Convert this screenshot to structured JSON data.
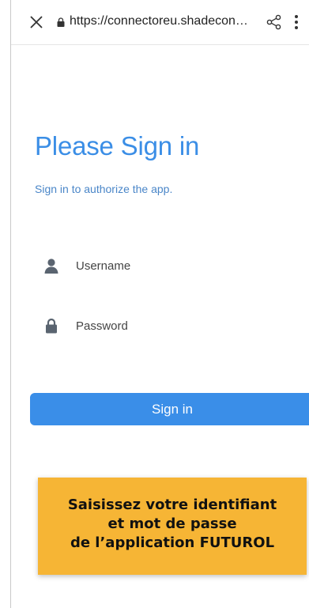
{
  "browser": {
    "url": "https://connectoreu.shadecon…",
    "icons": {
      "close": "close-icon",
      "lock": "lock-icon",
      "share": "share-icon",
      "menu": "more-vertical-icon"
    }
  },
  "login": {
    "title": "Please Sign in",
    "subtitle": "Sign in to authorize the app.",
    "username_placeholder": "Username",
    "password_placeholder": "Password",
    "username_icon": "user-icon",
    "password_icon": "lock-icon",
    "submit_label": "Sign in"
  },
  "callout": {
    "text": "Saisissez votre identifiant\net mot de passe\nde l’application FUTUROL"
  },
  "colors": {
    "accent": "#3a8ee8",
    "title": "#3b8ee6",
    "callout_bg": "#f6b535",
    "icon": "#5a6470"
  }
}
